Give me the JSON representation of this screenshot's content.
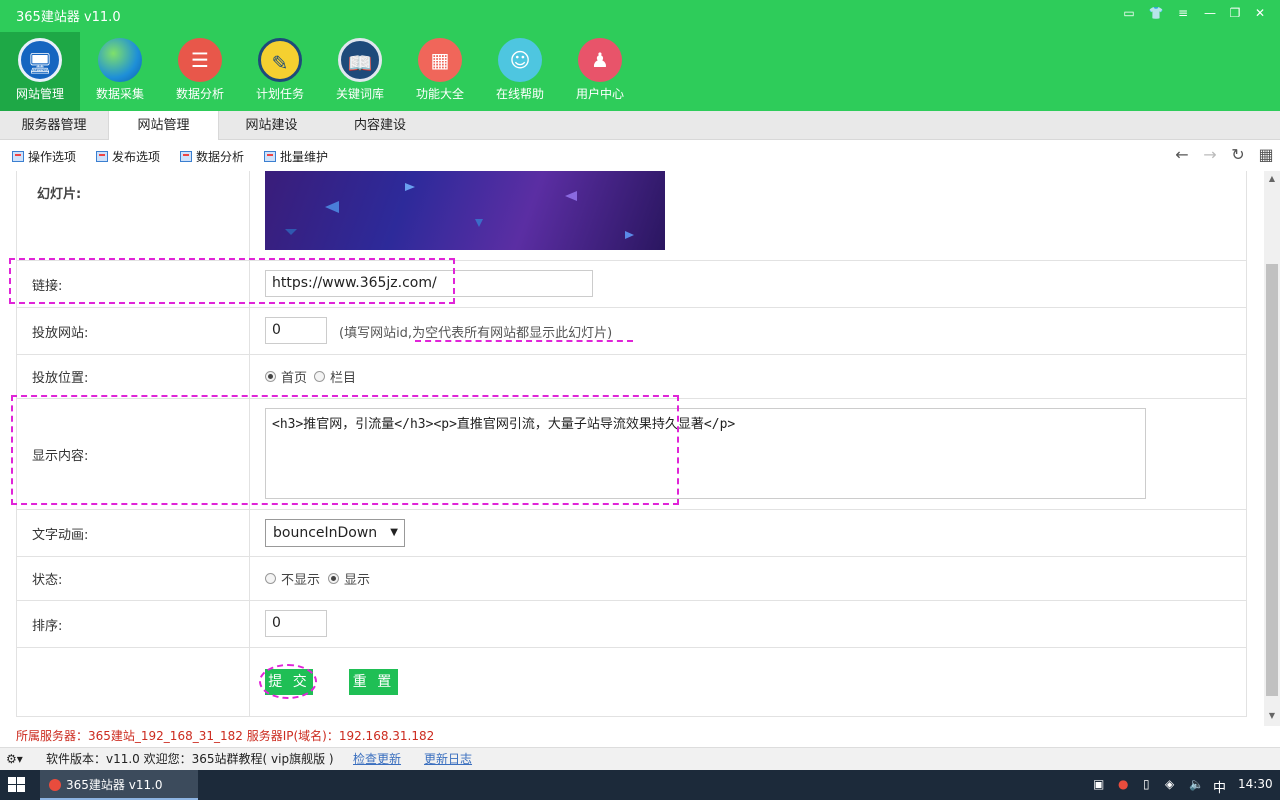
{
  "app": {
    "title": "365建站器 v11.0"
  },
  "window_controls": [
    "message",
    "shirt",
    "menu",
    "minimize",
    "maximize",
    "close"
  ],
  "toolbar": {
    "items": [
      {
        "label": "网站管理",
        "icon": "monitor-icon",
        "color": "#1565c0",
        "active": true
      },
      {
        "label": "数据采集",
        "icon": "edge-icon",
        "color": "#2a9fd8",
        "active": false
      },
      {
        "label": "数据分析",
        "icon": "database-icon",
        "color": "#e8574a",
        "active": false
      },
      {
        "label": "计划任务",
        "icon": "clock-icon",
        "color": "#f5c518",
        "active": false
      },
      {
        "label": "关键词库",
        "icon": "book-icon",
        "color": "#1e4a7a",
        "active": false
      },
      {
        "label": "功能大全",
        "icon": "grid-icon",
        "color": "#f0665a",
        "active": false
      },
      {
        "label": "在线帮助",
        "icon": "headset-icon",
        "color": "#4ec6e0",
        "active": false
      },
      {
        "label": "用户中心",
        "icon": "user-icon",
        "color": "#e8546a",
        "active": false
      }
    ]
  },
  "tabs": [
    {
      "label": "服务器管理",
      "active": false
    },
    {
      "label": "网站管理",
      "active": true
    },
    {
      "label": "网站建设",
      "active": false
    },
    {
      "label": "内容建设",
      "active": false
    }
  ],
  "subtoolbar": {
    "items": [
      "操作选项",
      "发布选项",
      "数据分析",
      "批量维护"
    ]
  },
  "form": {
    "slideshow_label": "幻灯片:",
    "link_label": "链接:",
    "link_value": "https://www.365jz.com/",
    "site_label": "投放网站:",
    "site_value": "0",
    "site_hint_prefix": "(填写网站id,",
    "site_hint_underlined": "为空代表所有网站都显示此幻灯片",
    "site_hint_suffix": ")",
    "position_label": "投放位置:",
    "position_options": [
      "首页",
      "栏目"
    ],
    "position_selected": "首页",
    "content_label": "显示内容:",
    "content_value": "<h3>推官网，引流量</h3><p>直推官网引流，大量子站导流效果持久显著</p>",
    "animation_label": "文字动画:",
    "animation_value": "bounceInDown",
    "status_label": "状态:",
    "status_options": [
      "不显示",
      "显示"
    ],
    "status_selected": "显示",
    "sort_label": "排序:",
    "sort_value": "0",
    "submit_label": "提 交",
    "reset_label": "重 置"
  },
  "status": {
    "server_line": "所属服务器：365建站_192_168_31_182 服务器IP(域名)：192.168.31.182",
    "version_text": "软件版本：v11.0  欢迎您：365站群教程( vip旗舰版 )",
    "check_update": "检查更新",
    "update_log": "更新日志"
  },
  "taskbar": {
    "app_label": "365建站器 v11.0",
    "ime": "中",
    "time": "14:30"
  },
  "colors": {
    "brand_green": "#2ecc5a",
    "button_green": "#1fbf55",
    "annotation_magenta": "#e024d8",
    "server_text_red": "#cc2b1f"
  }
}
